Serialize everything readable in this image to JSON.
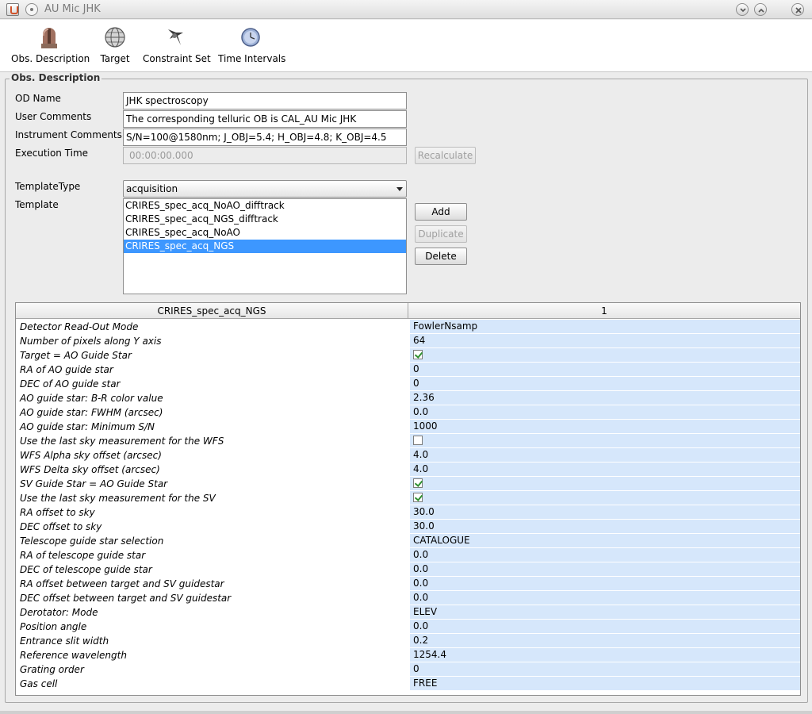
{
  "window": {
    "title": "AU Mic JHK"
  },
  "toolbar": {
    "items": [
      {
        "label": "Obs. Description",
        "icon": "obs-description-icon"
      },
      {
        "label": "Target",
        "icon": "globe-icon"
      },
      {
        "label": "Constraint Set",
        "icon": "constraint-icon"
      },
      {
        "label": "Time Intervals",
        "icon": "clock-icon"
      }
    ]
  },
  "panel": {
    "title": "Obs. Description"
  },
  "form": {
    "od_name": {
      "label": "OD Name",
      "value": "JHK spectroscopy"
    },
    "user_comments": {
      "label": "User Comments",
      "value": "The corresponding telluric OB is CAL_AU Mic JHK"
    },
    "instrument_comments": {
      "label": "Instrument Comments",
      "value": "S/N=100@1580nm; J_OBJ=5.4; H_OBJ=4.8; K_OBJ=4.5"
    },
    "execution_time": {
      "label": "Execution Time",
      "value": "00:00:00.000"
    },
    "recalculate_label": "Recalculate",
    "template_type": {
      "label": "TemplateType",
      "value": "acquisition"
    },
    "template": {
      "label": "Template"
    }
  },
  "templates": [
    {
      "name": "CRIRES_spec_acq_NoAO_difftrack",
      "selected": false
    },
    {
      "name": "CRIRES_spec_acq_NGS_difftrack",
      "selected": false
    },
    {
      "name": "CRIRES_spec_acq_NoAO",
      "selected": false
    },
    {
      "name": "CRIRES_spec_acq_NGS",
      "selected": true
    }
  ],
  "buttons": {
    "add": "Add",
    "duplicate": "Duplicate",
    "delete": "Delete"
  },
  "param_table": {
    "header_name": "CRIRES_spec_acq_NGS",
    "header_value": "1",
    "rows": [
      {
        "name": "Detector Read-Out Mode",
        "value": "FowlerNsamp"
      },
      {
        "name": "Number of pixels along Y axis",
        "value": "64"
      },
      {
        "name": "Target = AO Guide Star",
        "checkbox": true,
        "checked": true
      },
      {
        "name": "RA of AO guide star",
        "value": "0"
      },
      {
        "name": "DEC of AO guide star",
        "value": "0"
      },
      {
        "name": "AO guide star: B-R color value",
        "value": "2.36"
      },
      {
        "name": "AO guide star: FWHM (arcsec)",
        "value": "0.0"
      },
      {
        "name": "AO guide star: Minimum S/N",
        "value": "1000"
      },
      {
        "name": "Use the last sky measurement for the WFS",
        "checkbox": true,
        "checked": false
      },
      {
        "name": "WFS Alpha sky offset (arcsec)",
        "value": "4.0"
      },
      {
        "name": "WFS Delta sky offset (arcsec)",
        "value": "4.0"
      },
      {
        "name": "SV Guide Star = AO Guide Star",
        "checkbox": true,
        "checked": true
      },
      {
        "name": "Use the last sky measurement for the SV",
        "checkbox": true,
        "checked": true
      },
      {
        "name": "RA offset to sky",
        "value": "30.0"
      },
      {
        "name": "DEC offset to sky",
        "value": "30.0"
      },
      {
        "name": "Telescope guide star selection",
        "value": "CATALOGUE"
      },
      {
        "name": "RA of telescope guide star",
        "value": "0.0"
      },
      {
        "name": "DEC of telescope guide star",
        "value": "0.0"
      },
      {
        "name": "RA offset between target and SV guidestar",
        "value": "0.0"
      },
      {
        "name": "DEC offset between target and SV guidestar",
        "value": "0.0"
      },
      {
        "name": "Derotator: Mode",
        "value": "ELEV"
      },
      {
        "name": "Position angle",
        "value": "0.0"
      },
      {
        "name": "Entrance slit width",
        "value": "0.2"
      },
      {
        "name": "Reference wavelength",
        "value": "1254.4"
      },
      {
        "name": "Grating order",
        "value": "0"
      },
      {
        "name": "Gas cell",
        "value": "FREE"
      }
    ]
  }
}
